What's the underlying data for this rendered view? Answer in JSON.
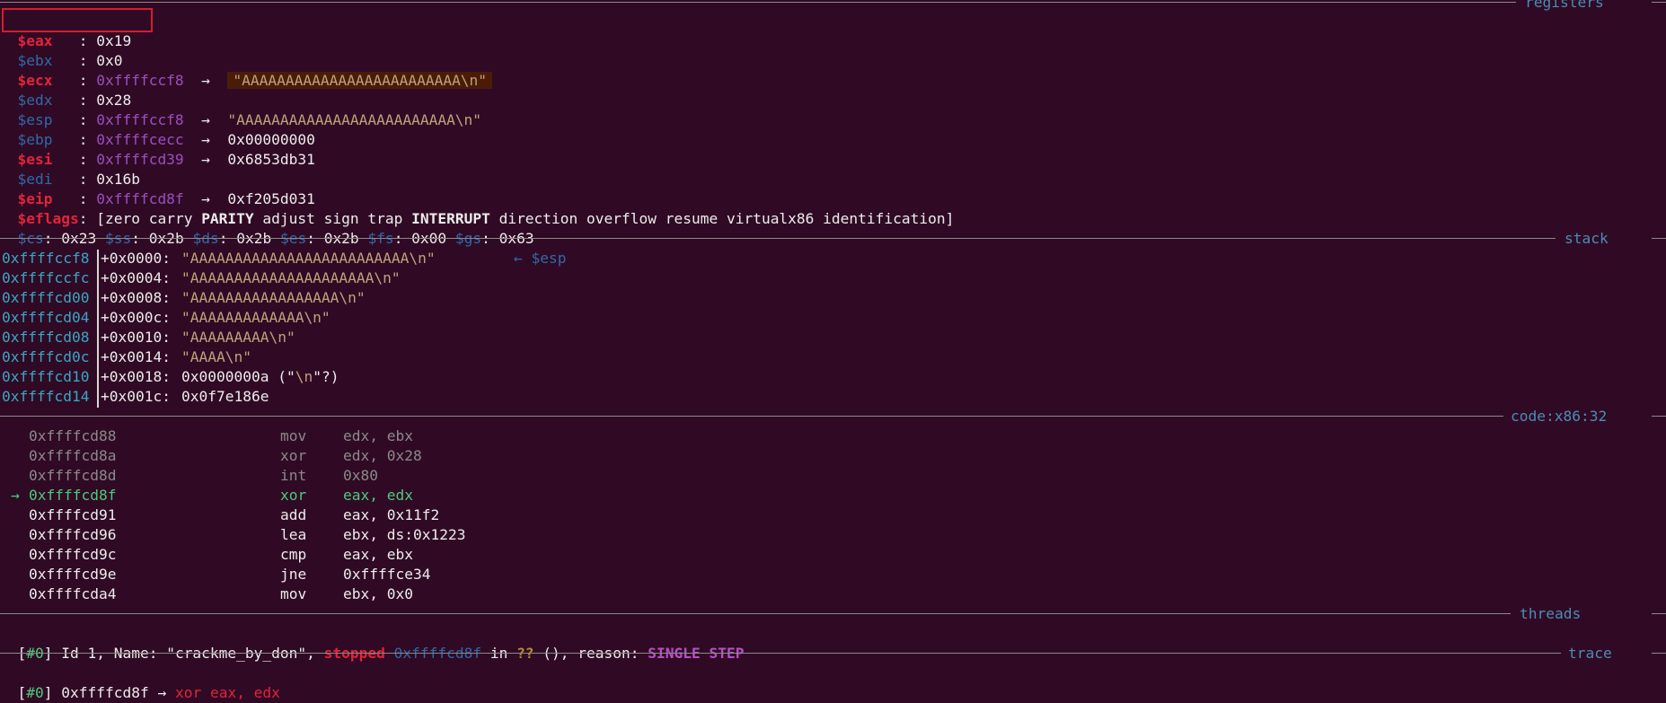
{
  "sections": {
    "registers": "registers",
    "stack": "stack",
    "code": "code:x86:32",
    "threads": "threads",
    "trace": "trace"
  },
  "registers": {
    "eax": {
      "name": "$eax",
      "sep": "   : ",
      "value": "0x19"
    },
    "ebx": {
      "name": "$ebx",
      "sep": "   : ",
      "value": "0x0"
    },
    "ecx": {
      "name": "$ecx",
      "sep": "   : ",
      "value": "0xffffccf8",
      "arrow": "  →  ",
      "deref": "\"AAAAAAAAAAAAAAAAAAAAAAAAA\\n\""
    },
    "edx": {
      "name": "$edx",
      "sep": "   : ",
      "value": "0x28"
    },
    "esp": {
      "name": "$esp",
      "sep": "   : ",
      "value": "0xffffccf8",
      "arrow": "  →  ",
      "deref": "\"AAAAAAAAAAAAAAAAAAAAAAAAA\\n\""
    },
    "ebp": {
      "name": "$ebp",
      "sep": "   : ",
      "value": "0xffffcecc",
      "arrow": "  →  ",
      "deref": "0x00000000"
    },
    "esi": {
      "name": "$esi",
      "sep": "   : ",
      "value": "0xffffcd39",
      "arrow": "  →  ",
      "deref": "0x6853db31"
    },
    "edi": {
      "name": "$edi",
      "sep": "   : ",
      "value": "0x16b"
    },
    "eip": {
      "name": "$eip",
      "sep": "   : ",
      "value": "0xffffcd8f",
      "arrow": "  →  ",
      "deref": "0xf205d031"
    },
    "eflags": {
      "name": "$eflags",
      "sep": ": ",
      "open": "[",
      "f1": "zero carry ",
      "f2": "PARITY",
      "f3": " adjust sign trap ",
      "f4": "INTERRUPT",
      "f5": " direction overflow resume virtualx86 identification",
      "close": "]"
    },
    "segments": [
      {
        "name": "$cs",
        "value": ": 0x23 "
      },
      {
        "name": "$ss",
        "value": ": 0x2b "
      },
      {
        "name": "$ds",
        "value": ": 0x2b "
      },
      {
        "name": "$es",
        "value": ": 0x2b "
      },
      {
        "name": "$fs",
        "value": ": 0x00 "
      },
      {
        "name": "$gs",
        "value": ": 0x63"
      }
    ]
  },
  "stack": [
    {
      "addr": "0xffffccf8",
      "offset": "+0x0000: ",
      "val": "\"AAAAAAAAAAAAAAAAAAAAAAAAA\\n\"",
      "ptr": "← $esp"
    },
    {
      "addr": "0xffffccfc",
      "offset": "+0x0004: ",
      "val": "\"AAAAAAAAAAAAAAAAAAAAA\\n\""
    },
    {
      "addr": "0xffffcd00",
      "offset": "+0x0008: ",
      "val": "\"AAAAAAAAAAAAAAAAA\\n\""
    },
    {
      "addr": "0xffffcd04",
      "offset": "+0x000c: ",
      "val": "\"AAAAAAAAAAAAA\\n\""
    },
    {
      "addr": "0xffffcd08",
      "offset": "+0x0010: ",
      "val": "\"AAAAAAAAA\\n\""
    },
    {
      "addr": "0xffffcd0c",
      "offset": "+0x0014: ",
      "val": "\"AAAA\\n\""
    },
    {
      "addr": "0xffffcd10",
      "offset": "+0x0018: ",
      "val": "0x0000000a (\"",
      "val2": "\\n",
      "val3": "\"?)"
    },
    {
      "addr": "0xffffcd14",
      "offset": "+0x001c: ",
      "val": "0x0f7e186e"
    }
  ],
  "code": [
    {
      "marker": "",
      "addr": "0xffffcd88",
      "mnem": "mov",
      "ops": "edx, ebx",
      "state": "past"
    },
    {
      "marker": "",
      "addr": "0xffffcd8a",
      "mnem": "xor",
      "ops": "edx, 0x28",
      "state": "past"
    },
    {
      "marker": "",
      "addr": "0xffffcd8d",
      "mnem": "int",
      "ops": "0x80",
      "state": "past"
    },
    {
      "marker": "→",
      "addr": "0xffffcd8f",
      "mnem": "xor",
      "ops": "eax, edx",
      "state": "current"
    },
    {
      "marker": "",
      "addr": "0xffffcd91",
      "mnem": "add",
      "ops": "eax, 0x11f2",
      "state": "next"
    },
    {
      "marker": "",
      "addr": "0xffffcd96",
      "mnem": "lea",
      "ops": "ebx, ds:0x1223",
      "state": "next"
    },
    {
      "marker": "",
      "addr": "0xffffcd9c",
      "mnem": "cmp",
      "ops": "eax, ebx",
      "state": "next"
    },
    {
      "marker": "",
      "addr": "0xffffcd9e",
      "mnem": "jne",
      "ops": "0xffffce34",
      "state": "next"
    },
    {
      "marker": "",
      "addr": "0xffffcda4",
      "mnem": "mov",
      "ops": "ebx, 0x0",
      "state": "next"
    }
  ],
  "threads": {
    "open": "[",
    "id": "#0",
    "close": "] ",
    "t1": "Id 1, Name: \"crackme_by_don\", ",
    "status": "stopped",
    "sp": " ",
    "addr": "0xffffcd8f",
    "t2": " in ",
    "func": "??",
    "t3": " (), reason: ",
    "reason": "SINGLE STEP"
  },
  "trace": {
    "open": "[",
    "id": "#0",
    "close": "] ",
    "addr": "0xffffcd8f",
    "arrow": " → ",
    "instr": "xor eax, edx"
  }
}
